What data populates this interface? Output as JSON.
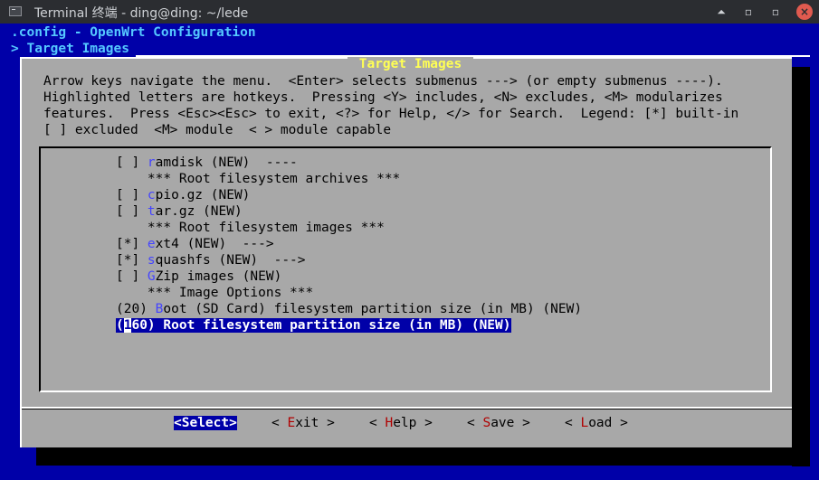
{
  "window": {
    "title": "Terminal 终端 - ding@ding: ~/lede",
    "controls": {
      "shade": "⏶",
      "minimize": "▫",
      "maximize": "▫",
      "close": "×"
    }
  },
  "header": {
    "config_line": ".config - OpenWrt Configuration",
    "breadcrumb": "> Target Images"
  },
  "dialog": {
    "title": " Target Images ",
    "help_lines": [
      "Arrow keys navigate the menu.  <Enter> selects submenus ---> (or empty submenus ----).",
      "Highlighted letters are hotkeys.  Pressing <Y> includes, <N> excludes, <M> modularizes",
      "features.  Press <Esc><Esc> to exit, <?> for Help, </> for Search.  Legend: [*] built-in",
      "[ ] excluded  <M> module  < > module capable"
    ]
  },
  "menu": {
    "items": [
      {
        "prefix": "[ ] ",
        "hotkey": "r",
        "rest": "amdisk (NEW)  ----"
      },
      {
        "prefix": "    ",
        "hotkey": "",
        "rest": "*** Root filesystem archives ***"
      },
      {
        "prefix": "[ ] ",
        "hotkey": "c",
        "rest": "pio.gz (NEW)"
      },
      {
        "prefix": "[ ] ",
        "hotkey": "t",
        "rest": "ar.gz (NEW)"
      },
      {
        "prefix": "    ",
        "hotkey": "",
        "rest": "*** Root filesystem images ***"
      },
      {
        "prefix": "[*] ",
        "hotkey": "e",
        "rest": "xt4 (NEW)  --->"
      },
      {
        "prefix": "[*] ",
        "hotkey": "s",
        "rest": "quashfs (NEW)  --->"
      },
      {
        "prefix": "[ ] ",
        "hotkey": "G",
        "rest": "Zip images (NEW)"
      },
      {
        "prefix": "    ",
        "hotkey": "",
        "rest": "*** Image Options ***"
      },
      {
        "prefix": "(20) ",
        "hotkey": "B",
        "rest": "oot (SD Card) filesystem partition size (in MB) (NEW)"
      }
    ],
    "selected": {
      "open": "(",
      "cursor_char": "1",
      "rest": "60) Root filesystem partition size (in MB) (NEW)"
    }
  },
  "buttons": {
    "select": "<Select>",
    "exit": {
      "pre": "< ",
      "hotkey": "E",
      "post": "xit >"
    },
    "help": {
      "pre": "< ",
      "hotkey": "H",
      "post": "elp >"
    },
    "save": {
      "pre": "< ",
      "hotkey": "S",
      "post": "ave >"
    },
    "load": {
      "pre": "< ",
      "hotkey": "L",
      "post": "oad >"
    }
  },
  "colors": {
    "terminal_bg": "#0000a8",
    "dialog_bg": "#a8a8a8",
    "title_text": "#ffff54",
    "hotkey": "#4444ff",
    "button_hotkey": "#b00000",
    "header_text": "#55c8ff"
  }
}
